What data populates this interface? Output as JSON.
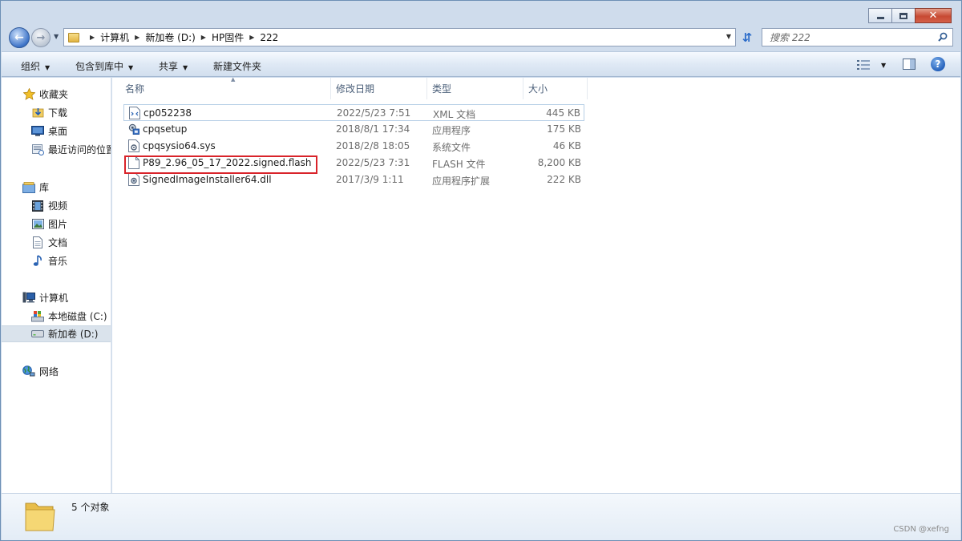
{
  "window": {
    "caption": {
      "minimize": "—",
      "maximize": "□",
      "close": "✕"
    }
  },
  "address": {
    "crumbs": [
      "计算机",
      "新加卷 (D:)",
      "HP固件",
      "222"
    ]
  },
  "search": {
    "placeholder": "搜索 222"
  },
  "toolbar": {
    "organize": "组织",
    "include_in_library": "包含到库中",
    "share": "共享",
    "new_folder": "新建文件夹"
  },
  "nav": {
    "favorites": {
      "header": "收藏夹",
      "items": [
        "下载",
        "桌面",
        "最近访问的位置"
      ]
    },
    "libraries": {
      "header": "库",
      "items": [
        "视频",
        "图片",
        "文档",
        "音乐"
      ]
    },
    "computer": {
      "header": "计算机",
      "items": [
        "本地磁盘 (C:)",
        "新加卷 (D:)"
      ],
      "selected": "新加卷 (D:)"
    },
    "network": {
      "header": "网络"
    }
  },
  "columns": {
    "name": "名称",
    "date": "修改日期",
    "type": "类型",
    "size": "大小"
  },
  "files": [
    {
      "name": "cp052238",
      "date": "2022/5/23 7:51",
      "type": "XML 文档",
      "size": "445 KB",
      "icon": "xml-file-icon"
    },
    {
      "name": "cpqsetup",
      "date": "2018/8/1 17:34",
      "type": "应用程序",
      "size": "175 KB",
      "icon": "application-icon"
    },
    {
      "name": "cpqsysio64.sys",
      "date": "2018/2/8 18:05",
      "type": "系统文件",
      "size": "46 KB",
      "icon": "system-file-icon"
    },
    {
      "name": "P89_2.96_05_17_2022.signed.flash",
      "date": "2022/5/23 7:31",
      "type": "FLASH 文件",
      "size": "8,200 KB",
      "icon": "generic-file-icon"
    },
    {
      "name": "SignedImageInstaller64.dll",
      "date": "2017/3/9 1:11",
      "type": "应用程序扩展",
      "size": "222 KB",
      "icon": "dll-file-icon"
    }
  ],
  "status": {
    "count": "5 个对象"
  },
  "watermark": "CSDN @xefng",
  "colors": {
    "highlight": "#d9232a",
    "accent": "#2a6bc9"
  }
}
